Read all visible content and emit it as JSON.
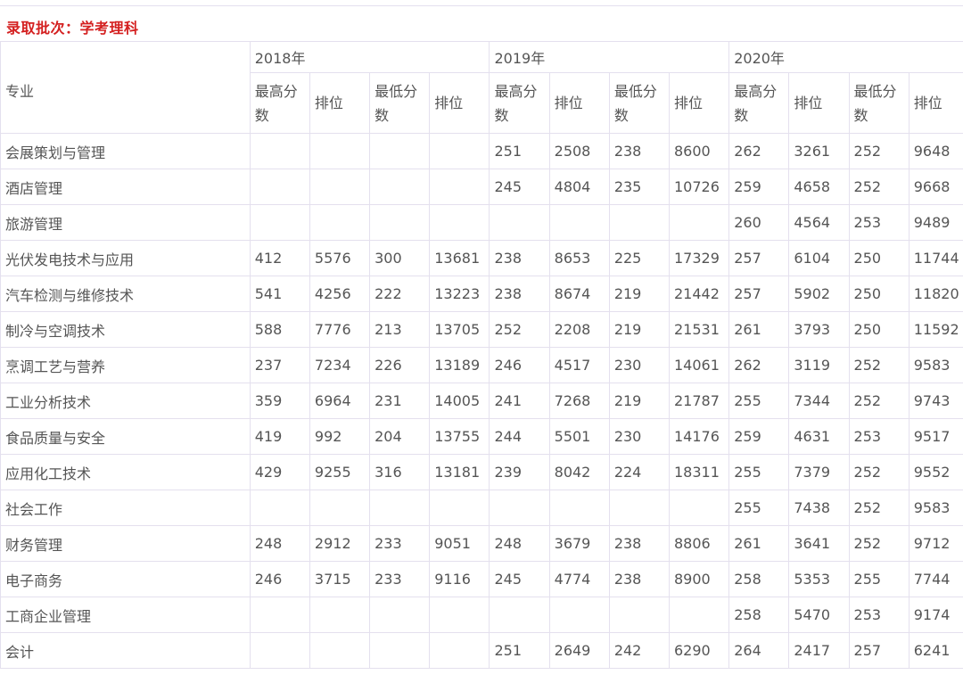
{
  "batch_label": "录取批次：学考理科",
  "major_header": "专业",
  "years": [
    "2018年",
    "2019年",
    "2020年"
  ],
  "sub_headers": [
    "最高分数",
    "排位",
    "最低分数",
    "排位"
  ],
  "rows": [
    {
      "major": "会展策划与管理",
      "values": [
        "",
        "",
        "",
        "",
        "251",
        "2508",
        "238",
        "8600",
        "262",
        "3261",
        "252",
        "9648"
      ]
    },
    {
      "major": "酒店管理",
      "values": [
        "",
        "",
        "",
        "",
        "245",
        "4804",
        "235",
        "10726",
        "259",
        "4658",
        "252",
        "9668"
      ]
    },
    {
      "major": "旅游管理",
      "values": [
        "",
        "",
        "",
        "",
        "",
        "",
        "",
        "",
        "260",
        "4564",
        "253",
        "9489"
      ]
    },
    {
      "major": "光伏发电技术与应用",
      "values": [
        "412",
        "5576",
        "300",
        "13681",
        "238",
        "8653",
        "225",
        "17329",
        "257",
        "6104",
        "250",
        "11744"
      ]
    },
    {
      "major": "汽车检测与维修技术",
      "values": [
        "541",
        "4256",
        "222",
        "13223",
        "238",
        "8674",
        "219",
        "21442",
        "257",
        "5902",
        "250",
        "11820"
      ]
    },
    {
      "major": "制冷与空调技术",
      "values": [
        "588",
        "7776",
        "213",
        "13705",
        "252",
        "2208",
        "219",
        "21531",
        "261",
        "3793",
        "250",
        "11592"
      ]
    },
    {
      "major": "烹调工艺与营养",
      "values": [
        "237",
        "7234",
        "226",
        "13189",
        "246",
        "4517",
        "230",
        "14061",
        "262",
        "3119",
        "252",
        "9583"
      ]
    },
    {
      "major": "工业分析技术",
      "values": [
        "359",
        "6964",
        "231",
        "14005",
        "241",
        "7268",
        "219",
        "21787",
        "255",
        "7344",
        "252",
        "9743"
      ]
    },
    {
      "major": "食品质量与安全",
      "values": [
        "419",
        "992",
        "204",
        "13755",
        "244",
        "5501",
        "230",
        "14176",
        "259",
        "4631",
        "253",
        "9517"
      ]
    },
    {
      "major": "应用化工技术",
      "values": [
        "429",
        "9255",
        "316",
        "13181",
        "239",
        "8042",
        "224",
        "18311",
        "255",
        "7379",
        "252",
        "9552"
      ]
    },
    {
      "major": "社会工作",
      "values": [
        "",
        "",
        "",
        "",
        "",
        "",
        "",
        "",
        "255",
        "7438",
        "252",
        "9583"
      ]
    },
    {
      "major": "财务管理",
      "values": [
        "248",
        "2912",
        "233",
        "9051",
        "248",
        "3679",
        "238",
        "8806",
        "261",
        "3641",
        "252",
        "9712"
      ]
    },
    {
      "major": "电子商务",
      "values": [
        "246",
        "3715",
        "233",
        "9116",
        "245",
        "4774",
        "238",
        "8900",
        "258",
        "5353",
        "255",
        "7744"
      ]
    },
    {
      "major": "工商企业管理",
      "values": [
        "",
        "",
        "",
        "",
        "",
        "",
        "",
        "",
        "258",
        "5470",
        "253",
        "9174"
      ]
    },
    {
      "major": "会计",
      "values": [
        "",
        "",
        "",
        "",
        "251",
        "2649",
        "242",
        "6290",
        "264",
        "2417",
        "257",
        "6241"
      ]
    }
  ]
}
